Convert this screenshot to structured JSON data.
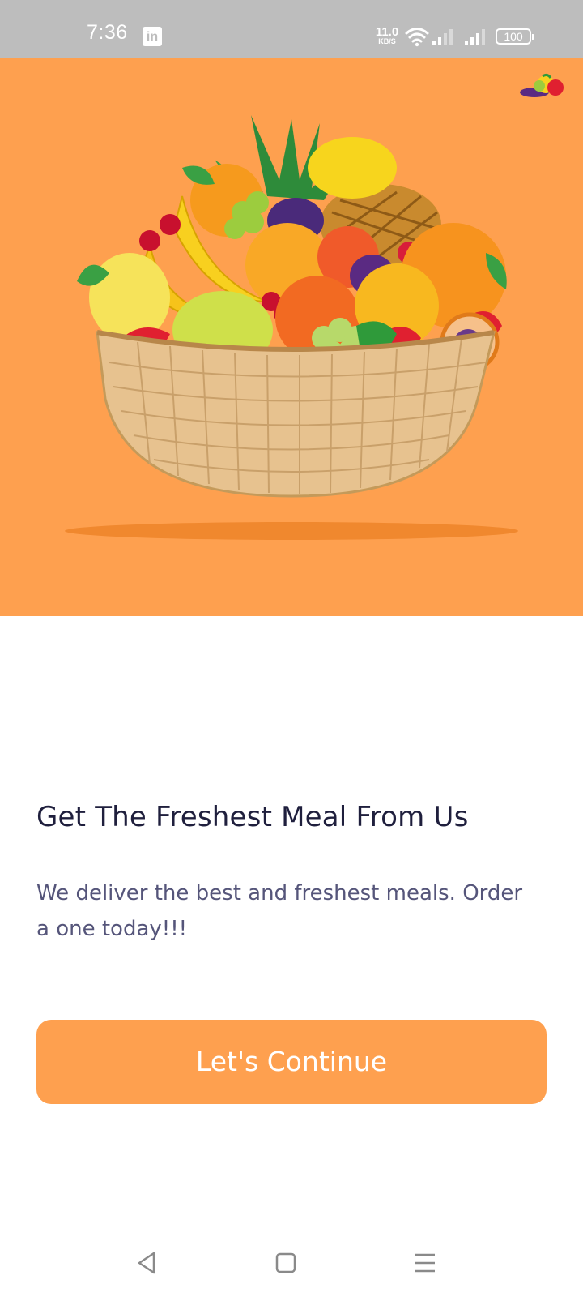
{
  "status_bar": {
    "time": "7:36",
    "app_icon": "linkedin-icon",
    "net_speed_value": "11.0",
    "net_speed_unit": "KB/S",
    "battery": "100"
  },
  "hero": {
    "background_color": "#fea04f",
    "image": "fruit-basket-illustration",
    "corner_icon": "fruit-logo-icon"
  },
  "content": {
    "headline": "Get The Freshest Meal From Us",
    "subtext": "We deliver the best and freshest meals. Order a one today!!!",
    "cta_label": "Let's Continue"
  },
  "colors": {
    "accent": "#fea04f",
    "headline": "#1f1f3d",
    "subtext": "#55557a"
  },
  "nav_bar": {
    "icons": [
      "back-icon",
      "home-icon",
      "recents-icon"
    ]
  }
}
